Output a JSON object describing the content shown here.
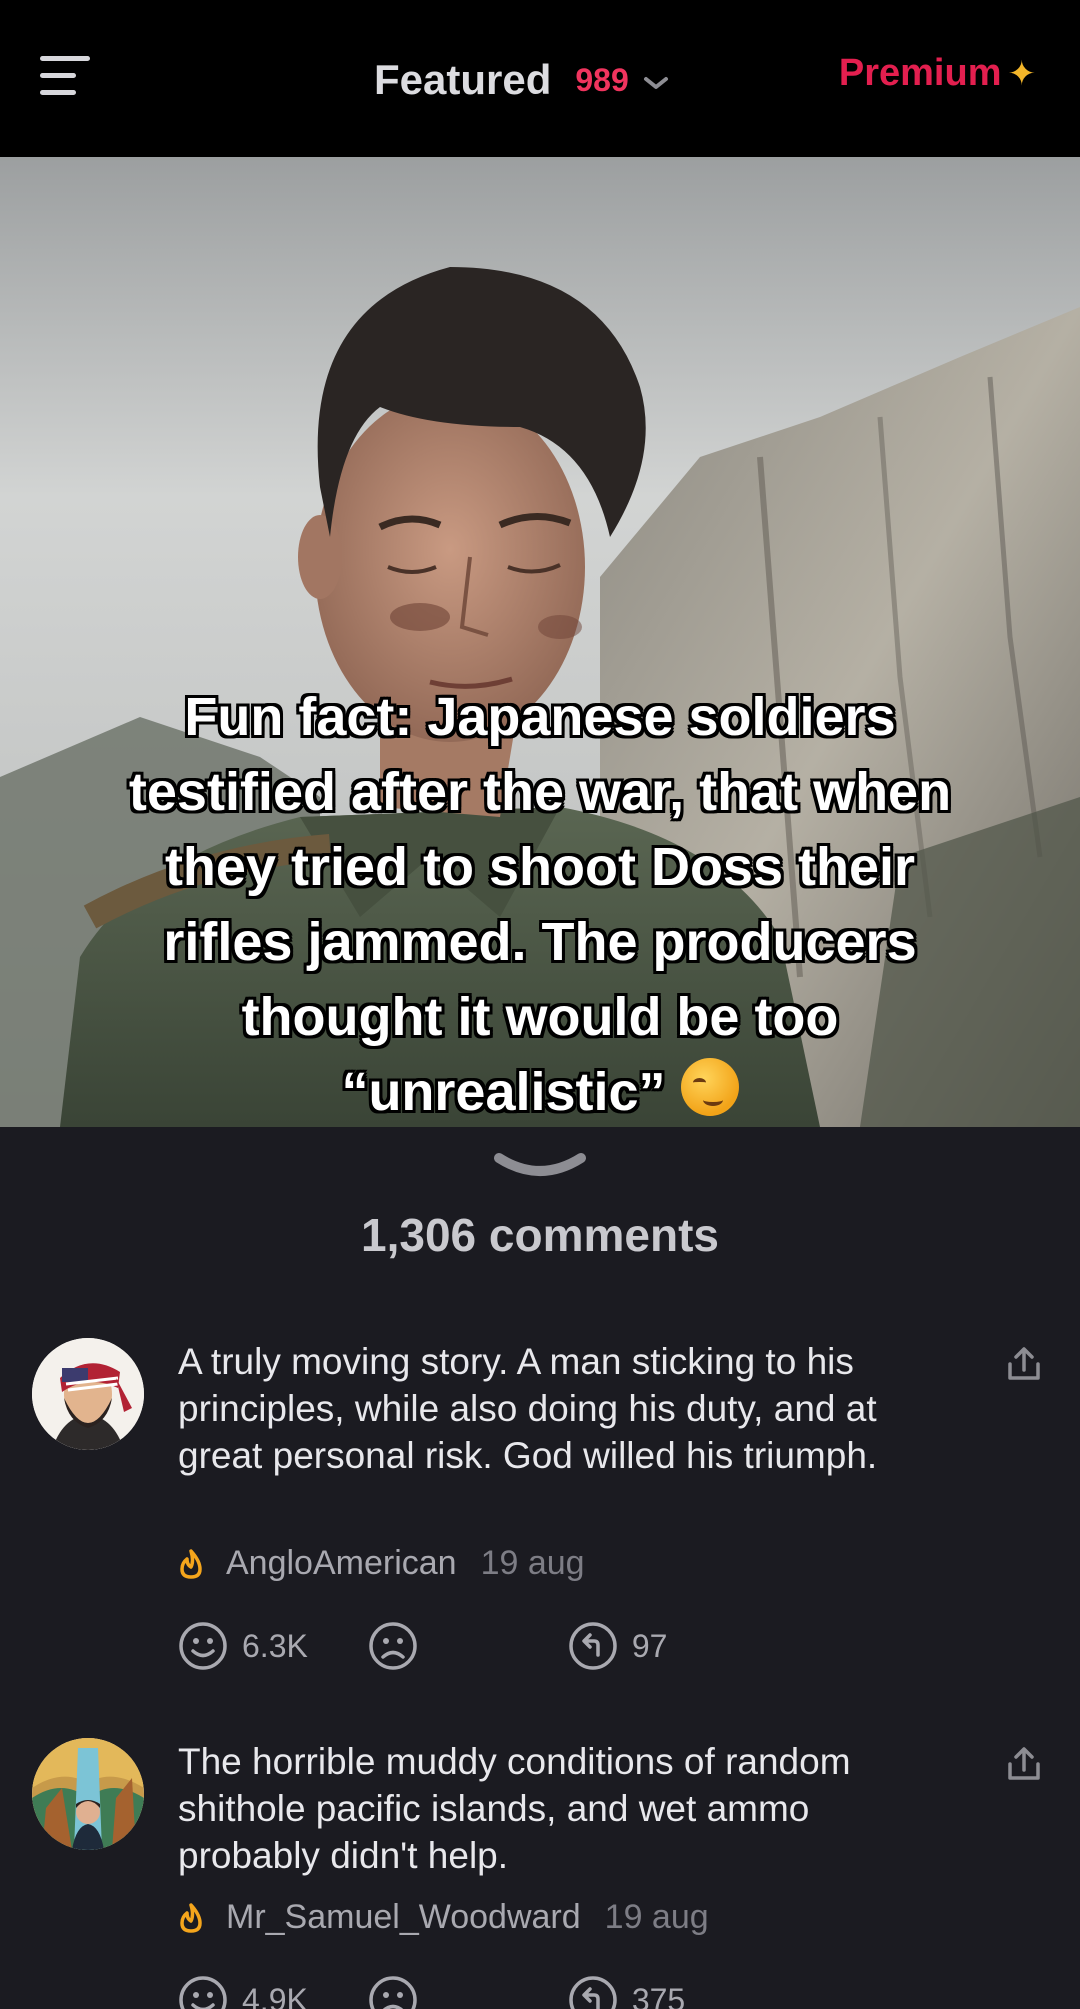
{
  "header": {
    "title": "Featured",
    "count": "989",
    "premium_label": "Premium",
    "premium_icon": "sparkle-icon",
    "accent_color": "#e31f4f",
    "sparkle_color": "#f4b62a"
  },
  "post": {
    "caption": "Fun fact: Japanese soldiers testified after the war, that when they tried to shoot Doss their rifles jammed. The producers thought it would be too “unrealistic”"
  },
  "comments_count": "1,306 comments",
  "comments": [
    {
      "text": "A truly moving story. A man sticking to his principles, while also doing his duty, and at great personal risk. God willed his triumph.",
      "username": "AngloAmerican",
      "date": "19 aug",
      "likes": "6.3K",
      "replies": "97"
    },
    {
      "text": "The horrible muddy conditions of random shithole pacific islands, and wet ammo probably didn't help.",
      "username": "Mr_Samuel_Woodward",
      "date": "19 aug",
      "likes": "4.9K",
      "replies": "375"
    }
  ]
}
